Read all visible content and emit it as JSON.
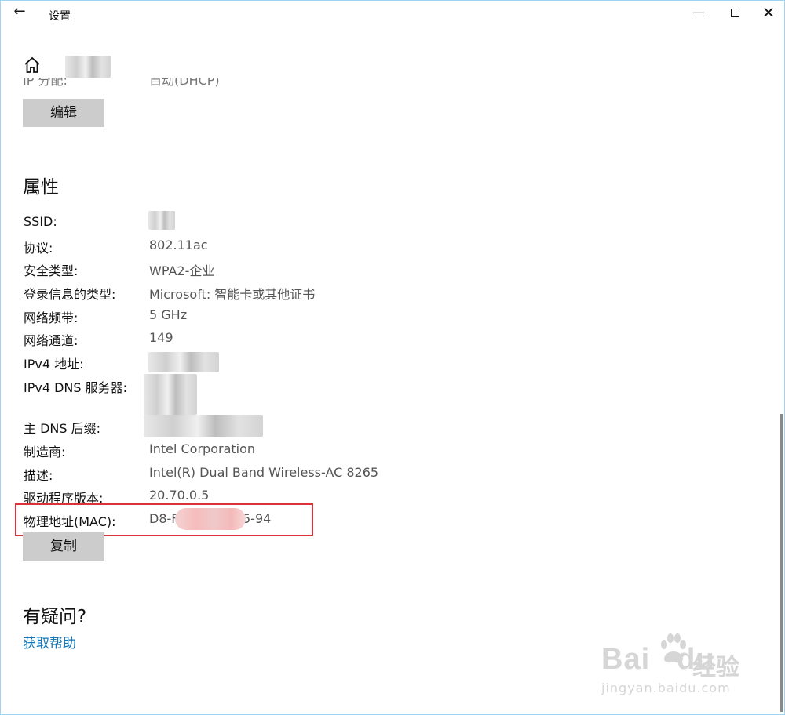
{
  "window": {
    "title": "设置",
    "back_icon": "←",
    "minimize_icon": "—",
    "close_icon": "✕"
  },
  "header": {
    "home_icon": "home-icon"
  },
  "ip_assignment": {
    "label": "IP 分配:",
    "value": "自动(DHCP)",
    "edit_button": "编辑"
  },
  "properties": {
    "title": "属性",
    "rows": [
      {
        "label": "SSID:",
        "value": ""
      },
      {
        "label": "协议:",
        "value": "802.11ac"
      },
      {
        "label": "安全类型:",
        "value": "WPA2-企业"
      },
      {
        "label": "登录信息的类型:",
        "value": "Microsoft: 智能卡或其他证书"
      },
      {
        "label": "网络频带:",
        "value": "5 GHz"
      },
      {
        "label": "网络通道:",
        "value": "149"
      },
      {
        "label": "IPv4 地址:",
        "value": ""
      },
      {
        "label": "IPv4 DNS 服务器:",
        "value": ""
      },
      {
        "label": "主 DNS 后缀:",
        "value": ""
      },
      {
        "label": "制造商:",
        "value": "Intel Corporation"
      },
      {
        "label": "描述:",
        "value": "Intel(R) Dual Band Wireless-AC 8265"
      },
      {
        "label": "驱动程序版本:",
        "value": "20.70.0.5"
      },
      {
        "label": "物理地址(MAC):",
        "value": "D8-F",
        "value_tail": "5-94"
      }
    ],
    "copy_button": "复制"
  },
  "help": {
    "title": "有疑问?",
    "link": "获取帮助"
  },
  "colors": {
    "button_bg": "#cccccc",
    "link": "#1477b8",
    "highlight_border": "#d9323b"
  },
  "watermark": {
    "brand": "Bai",
    "brand_tail": "du",
    "cn": "经验",
    "url": "jingyan.baidu.com"
  }
}
